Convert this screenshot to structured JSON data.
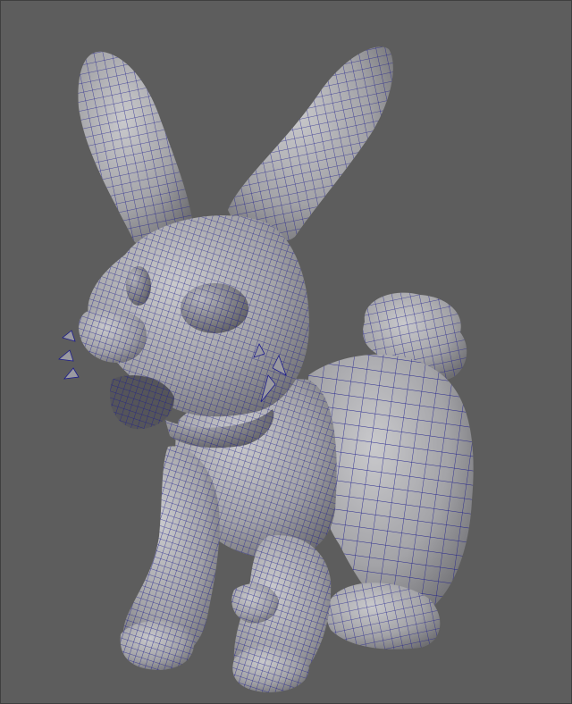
{
  "viewport": {
    "background": "#5d5d5d",
    "shading": "wireframe-on-shaded"
  },
  "model": {
    "subject": "rabbit",
    "surface_color": "#a8a8ab",
    "shadow_color": "#6e6e72",
    "wire_color": "#1c1c8c"
  },
  "icons": [
    "rabbit-model-icon"
  ]
}
